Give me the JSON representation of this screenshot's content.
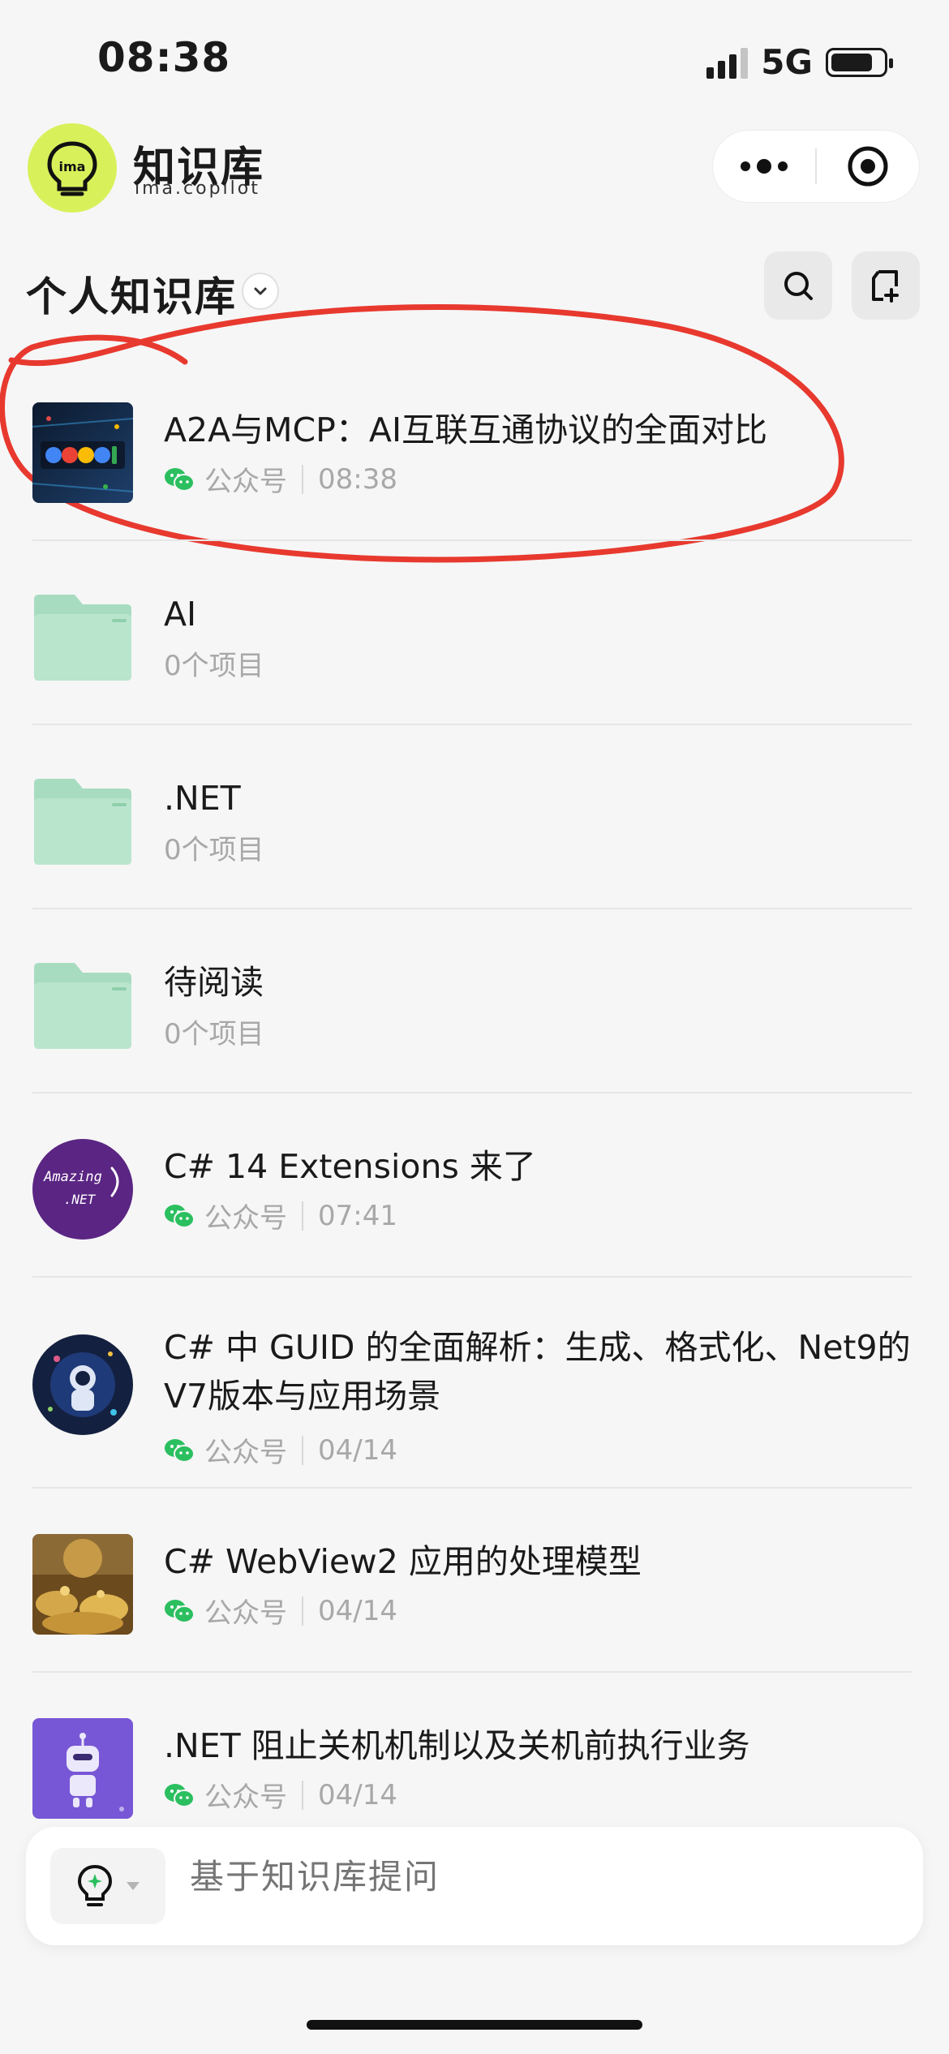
{
  "status_bar": {
    "time": "08:38",
    "network": "5G"
  },
  "header": {
    "logo_text": "ima",
    "app_name": "知识库",
    "app_sub": "ima.copilot"
  },
  "knowledge_base": {
    "title": "个人知识库"
  },
  "items": [
    {
      "title": "A2A与MCP：AI互联互通协议的全面对比",
      "source": "公众号",
      "time": "08:38",
      "kind": "article"
    },
    {
      "title": "AI",
      "count": "0个项目",
      "kind": "folder"
    },
    {
      "title": ".NET",
      "count": "0个项目",
      "kind": "folder"
    },
    {
      "title": "待阅读",
      "count": "0个项目",
      "kind": "folder"
    },
    {
      "title": "C# 14 Extensions 来了",
      "source": "公众号",
      "time": "07:41",
      "kind": "article",
      "thumb_text": [
        "Amazing",
        ".NET"
      ]
    },
    {
      "title": "C# 中 GUID 的全面解析：生成、格式化、Net9的V7版本与应用场景",
      "source": "公众号",
      "time": "04/14",
      "kind": "article"
    },
    {
      "title": "C# WebView2 应用的处理模型",
      "source": "公众号",
      "time": "04/14",
      "kind": "article"
    },
    {
      "title": ".NET 阻止关机机制以及关机前执行业务",
      "source": "公众号",
      "time": "04/14",
      "kind": "article"
    }
  ],
  "ask_bar": {
    "placeholder": "基于知识库提问"
  },
  "colors": {
    "brand": "#d8f15a",
    "folder": "#a8dcc0",
    "wechat": "#2bbf5f",
    "annotation": "#e8392f"
  }
}
